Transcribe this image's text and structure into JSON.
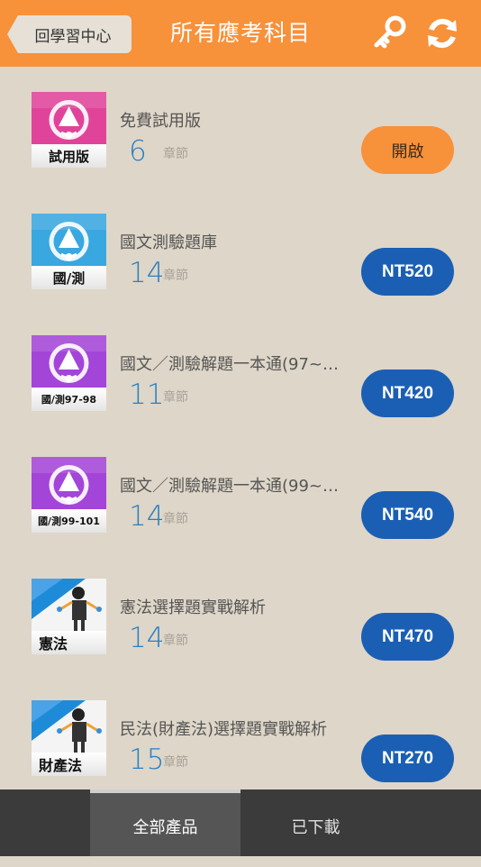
{
  "header": {
    "back_label": "回學習中心",
    "title": "所有應考科目",
    "key_icon": "key-icon",
    "refresh_icon": "refresh-icon"
  },
  "unit_label": "章節",
  "colors": {
    "header": "#f7913a",
    "background": "#ded6c8",
    "price_button": "#1a5fb4",
    "count_text": "#2a7fc0"
  },
  "products": [
    {
      "name": "免費試用版",
      "count": "6",
      "thumb_label": "試用版",
      "button": "開啟",
      "thumb_color": "#e0449a",
      "thumb_style": "bell"
    },
    {
      "name": "國文測驗題庫",
      "count": "14",
      "thumb_label": "國/測",
      "button": "NT520",
      "thumb_color": "#39a7e0",
      "thumb_style": "bell"
    },
    {
      "name": "國文／測驗解題一本通(97~…",
      "count": "11",
      "thumb_label": "國/測97-98",
      "button": "NT420",
      "thumb_color": "#a345d8",
      "thumb_style": "bell"
    },
    {
      "name": "國文／測驗解題一本通(99~…",
      "count": "14",
      "thumb_label": "國/測99-101",
      "button": "NT540",
      "thumb_color": "#a345d8",
      "thumb_style": "bell"
    },
    {
      "name": "憲法選擇題實戰解析",
      "count": "14",
      "thumb_label": "憲法",
      "button": "NT470",
      "thumb_color": "#1e8bd8",
      "thumb_style": "figure"
    },
    {
      "name": "民法(財產法)選擇題實戰解析",
      "count": "15",
      "thumb_label": "財產法",
      "button": "NT270",
      "thumb_color": "#1e8bd8",
      "thumb_style": "figure"
    }
  ],
  "tabs": {
    "all_products": "全部產品",
    "downloaded": "已下載"
  }
}
